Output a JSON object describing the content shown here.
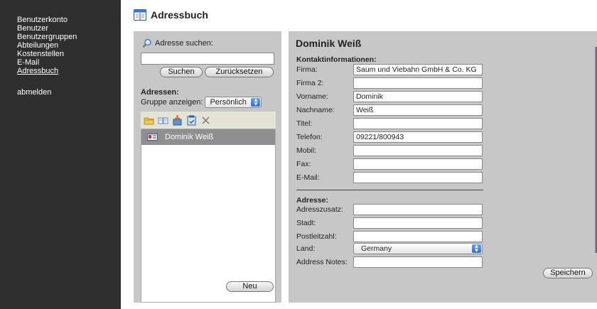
{
  "sidebar": {
    "items": [
      {
        "label": "Benutzerkonto"
      },
      {
        "label": "Benutzer"
      },
      {
        "label": "Benutzergruppen"
      },
      {
        "label": "Abteilungen"
      },
      {
        "label": "Kostenstellen"
      },
      {
        "label": "E-Mail"
      },
      {
        "label": "Adressbuch",
        "active": true
      }
    ],
    "logout": "abmelden"
  },
  "header": {
    "title": "Adressbuch",
    "icon": "address-book-icon"
  },
  "search": {
    "label": "Adresse suchen:",
    "value": "",
    "search_button": "Suchen",
    "reset_button": "Zurücksetzen"
  },
  "addresses": {
    "heading": "Adressen:",
    "group_label": "Gruppe anzeigen:",
    "group_selected": "Persönlich",
    "toolbar_icons": [
      "new-folder-icon",
      "copy-icon",
      "import-icon",
      "export-icon",
      "delete-icon"
    ],
    "list": [
      {
        "name": "Dominik Weiß",
        "selected": true
      }
    ],
    "new_button": "Neu"
  },
  "contact": {
    "name": "Dominik Weiß",
    "section_contact": "Kontaktinformationen:",
    "fields": {
      "firma": {
        "label": "Firma:",
        "value": "Saum und Viebahn GmbH & Co. KG"
      },
      "firma2": {
        "label": "Firma 2:",
        "value": ""
      },
      "vorname": {
        "label": "Vorname:",
        "value": "Dominik"
      },
      "nachname": {
        "label": "Nachname:",
        "value": "Weiß"
      },
      "titel": {
        "label": "Titel:",
        "value": ""
      },
      "telefon": {
        "label": "Telefon:",
        "value": "09221/800943"
      },
      "mobil": {
        "label": "Mobil:",
        "value": ""
      },
      "fax": {
        "label": "Fax:",
        "value": ""
      },
      "email": {
        "label": "E-Mail:",
        "value": ""
      }
    },
    "section_address": "Adresse:",
    "address": {
      "zusatz": {
        "label": "Adresszusatz:",
        "value": ""
      },
      "stadt": {
        "label": "Stadt:",
        "value": ""
      },
      "plz": {
        "label": "Postleitzahl:",
        "value": ""
      },
      "land": {
        "label": "Land:",
        "value": "Germany"
      },
      "notes": {
        "label": "Address Notes:",
        "value": ""
      }
    },
    "save_button": "Speichern"
  }
}
